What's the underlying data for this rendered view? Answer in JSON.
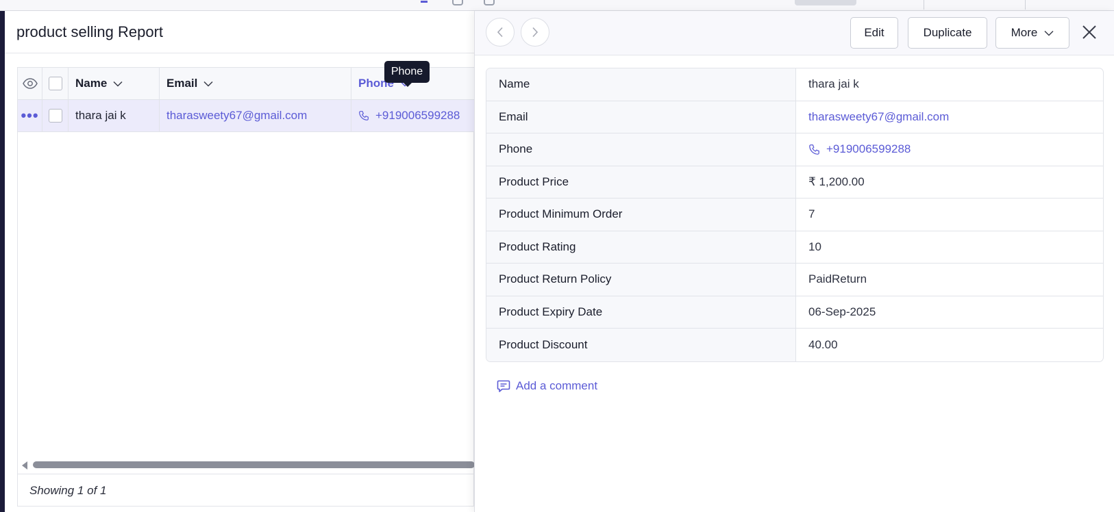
{
  "report": {
    "title": "product selling Report",
    "columns": [
      {
        "label": "Name"
      },
      {
        "label": "Email"
      },
      {
        "label": "Phone"
      }
    ],
    "row": {
      "name": "thara jai k",
      "email": "tharasweety67@gmail.com",
      "phone": "+919006599288"
    },
    "tooltip": "Phone",
    "footer": "Showing 1 of 1"
  },
  "detail": {
    "toolbar": {
      "edit_label": "Edit",
      "duplicate_label": "Duplicate",
      "more_label": "More"
    },
    "fields": [
      {
        "label": "Name",
        "value": "thara jai k"
      },
      {
        "label": "Email",
        "value": "tharasweety67@gmail.com"
      },
      {
        "label": "Phone",
        "value": "+919006599288"
      },
      {
        "label": "Product Price",
        "value": "₹ 1,200.00"
      },
      {
        "label": "Product Minimum Order",
        "value": "7"
      },
      {
        "label": "Product Rating",
        "value": "10"
      },
      {
        "label": "Product Return Policy",
        "value": "PaidReturn"
      },
      {
        "label": "Product Expiry Date",
        "value": "06-Sep-2025"
      },
      {
        "label": "Product Discount",
        "value": "40.00"
      }
    ],
    "add_comment_label": "Add a comment"
  },
  "icons": {
    "eye": "eye-icon",
    "phone": "phone-icon",
    "chevron": "chevron-down-icon",
    "prev": "chevron-left-icon",
    "next": "chevron-right-icon",
    "close": "close-icon",
    "comment": "comment-icon",
    "more_dots": "more-actions-icon"
  },
  "colors": {
    "accent": "#5b5bd6",
    "selected_row": "#ecebfb",
    "tooltip_bg": "#161a2c"
  }
}
